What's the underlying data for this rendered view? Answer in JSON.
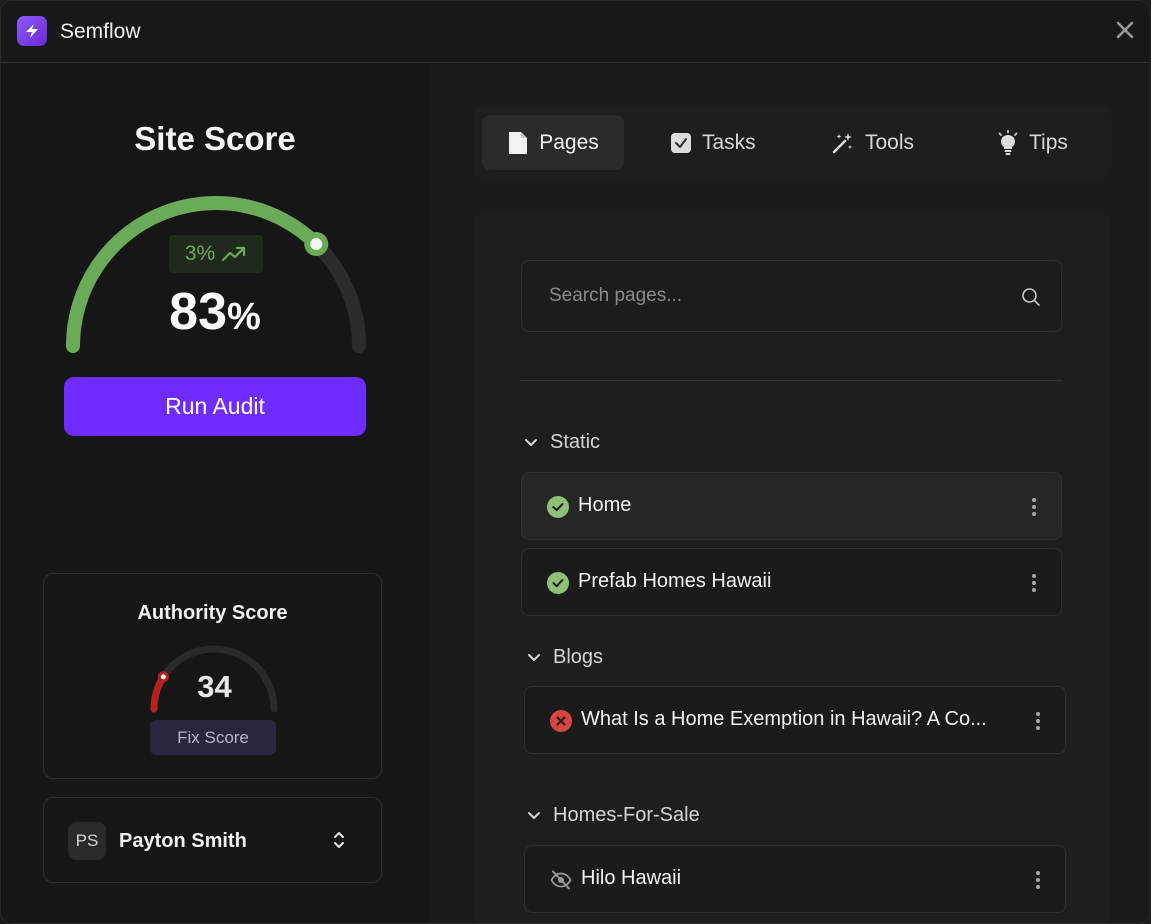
{
  "app": {
    "title": "Semflow"
  },
  "score": {
    "title": "Site Score",
    "trend": "3%",
    "value": "83",
    "unit": "%",
    "level": 0.83,
    "run_audit_label": "Run Audit"
  },
  "authority": {
    "title": "Authority Score",
    "value": "34",
    "level": 0.05,
    "fix_label": "Fix Score"
  },
  "user": {
    "initials": "PS",
    "name": "Payton Smith"
  },
  "tabs": [
    {
      "label": "Pages",
      "icon": "page-icon",
      "active": true
    },
    {
      "label": "Tasks",
      "icon": "checkbox-icon",
      "active": false
    },
    {
      "label": "Tools",
      "icon": "magic-wand-icon",
      "active": false
    },
    {
      "label": "Tips",
      "icon": "lightbulb-icon",
      "active": false
    }
  ],
  "search": {
    "placeholder": "Search pages..."
  },
  "groups": [
    {
      "name": "Static",
      "pages": [
        {
          "title": "Home",
          "status": "ok"
        },
        {
          "title": "Prefab Homes Hawaii",
          "status": "ok"
        }
      ]
    },
    {
      "name": "Blogs",
      "pages": [
        {
          "title": "What Is a Home Exemption in Hawaii? A Co...",
          "status": "error"
        }
      ]
    },
    {
      "name": "Homes-For-Sale",
      "pages": [
        {
          "title": "Hilo Hawaii",
          "status": "hidden"
        }
      ]
    }
  ],
  "colors": {
    "accent": "#6f2cff",
    "gauge_green": "#6aab57",
    "gauge_red": "#b52020",
    "ok": "#8fbf78",
    "error": "#d9463f"
  }
}
